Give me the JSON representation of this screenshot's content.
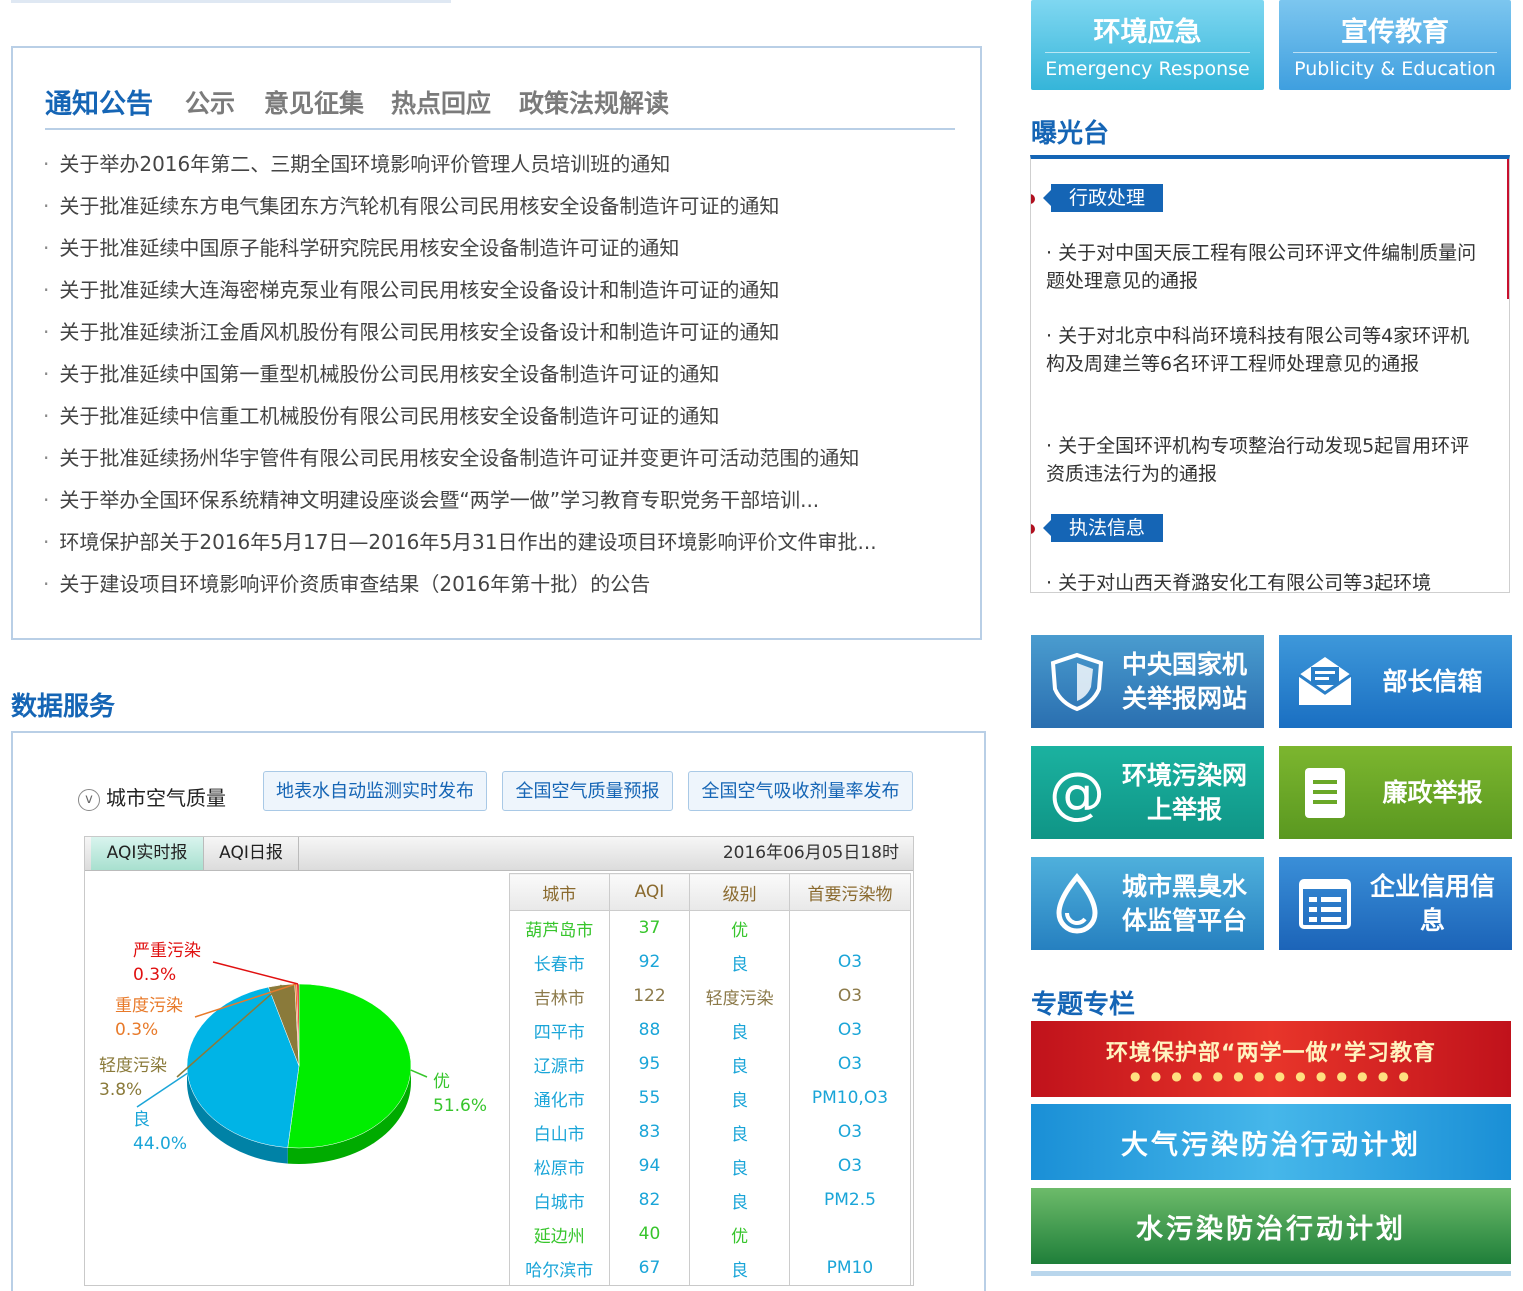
{
  "notice": {
    "tabs": [
      "通知公告",
      "公示",
      "意见征集",
      "热点回应",
      "政策法规解读"
    ],
    "items": [
      "关于举办2016年第二、三期全国环境影响评价管理人员培训班的通知",
      "关于批准延续东方电气集团东方汽轮机有限公司民用核安全设备制造许可证的通知",
      "关于批准延续中国原子能科学研究院民用核安全设备制造许可证的通知",
      "关于批准延续大连海密梯克泵业有限公司民用核安全设备设计和制造许可证的通知",
      "关于批准延续浙江金盾风机股份有限公司民用核安全设备设计和制造许可证的通知",
      "关于批准延续中国第一重型机械股份公司民用核安全设备制造许可证的通知",
      "关于批准延续中信重工机械股份有限公司民用核安全设备制造许可证的通知",
      "关于批准延续扬州华宇管件有限公司民用核安全设备制造许可证并变更许可活动范围的通知",
      "关于举办全国环保系统精神文明建设座谈会暨“两学一做”学习教育专职党务干部培训...",
      "环境保护部关于2016年5月17日—2016年5月31日作出的建设项目环境影响评价文件审批...",
      "关于建设项目环境影响评价资质审查结果（2016年第十批）的公告"
    ]
  },
  "data_service": {
    "title": "数据服务",
    "toggle_label": "城市空气质量",
    "toggle_icon": "v",
    "buttons": [
      "地表水自动监测实时发布",
      "全国空气质量预报",
      "全国空气吸收剂量率发布"
    ],
    "aqi_tabs": [
      "AQI实时报",
      "AQI日报"
    ],
    "date": "2016年06月05日18时",
    "table_headers": [
      "城市",
      "AQI",
      "级别",
      "首要污染物"
    ],
    "rows": [
      {
        "city": "葫芦岛市",
        "aqi": "37",
        "level": "优",
        "pollutant": "",
        "cls": "lv-you"
      },
      {
        "city": "长春市",
        "aqi": "92",
        "level": "良",
        "pollutant": "O3",
        "cls": "lv-liang"
      },
      {
        "city": "吉林市",
        "aqi": "122",
        "level": "轻度污染",
        "pollutant": "O3",
        "cls": "lv-qingdu"
      },
      {
        "city": "四平市",
        "aqi": "88",
        "level": "良",
        "pollutant": "O3",
        "cls": "lv-liang"
      },
      {
        "city": "辽源市",
        "aqi": "95",
        "level": "良",
        "pollutant": "O3",
        "cls": "lv-liang"
      },
      {
        "city": "通化市",
        "aqi": "55",
        "level": "良",
        "pollutant": "PM10,O3",
        "cls": "lv-liang"
      },
      {
        "city": "白山市",
        "aqi": "83",
        "level": "良",
        "pollutant": "O3",
        "cls": "lv-liang"
      },
      {
        "city": "松原市",
        "aqi": "94",
        "level": "良",
        "pollutant": "O3",
        "cls": "lv-liang"
      },
      {
        "city": "白城市",
        "aqi": "82",
        "level": "良",
        "pollutant": "PM2.5",
        "cls": "lv-liang"
      },
      {
        "city": "延边州",
        "aqi": "40",
        "level": "优",
        "pollutant": "",
        "cls": "lv-you"
      },
      {
        "city": "哈尔滨市",
        "aqi": "67",
        "level": "良",
        "pollutant": "PM10",
        "cls": "lv-liang"
      }
    ],
    "colors": {
      "you": "#00ee00",
      "liang": "#00b4e6",
      "qingdu": "#8a7a3a",
      "zhongdu": "#e87a2a",
      "yanzhong": "#e01010"
    }
  },
  "chart_data": {
    "type": "pie",
    "slices": [
      {
        "label": "优",
        "value": 51.6,
        "text": "51.6%",
        "color": "#00ee00"
      },
      {
        "label": "良",
        "value": 44.0,
        "text": "44.0%",
        "color": "#00b4e6"
      },
      {
        "label": "轻度污染",
        "value": 3.8,
        "text": "3.8%",
        "color": "#8a7a3a"
      },
      {
        "label": "重度污染",
        "value": 0.3,
        "text": "0.3%",
        "color": "#e87a2a"
      },
      {
        "label": "严重污染",
        "value": 0.3,
        "text": "0.3%",
        "color": "#e01010"
      }
    ]
  },
  "right": {
    "tile_emergency": {
      "cn": "环境应急",
      "en": "Emergency Response"
    },
    "tile_publicity": {
      "cn": "宣传教育",
      "en": "Publicity & Education"
    },
    "exposure_title": "曝光台",
    "exposure": {
      "cat1": "行政处理",
      "cat1_items": [
        "· 关于对中国天辰工程有限公司环评文件编制质量问题处理意见的通报",
        "· 关于对北京中科尚环境科技有限公司等4家环评机构及周建兰等6名环评工程师处理意见的通报",
        "· 关于全国环评机构专项整治行动发现5起冒用环评资质违法行为的通报"
      ],
      "cat2": "执法信息",
      "cat2_items": [
        "· 关于对山西天脊潞安化工有限公司等3起环境"
      ]
    },
    "tiles": {
      "jubao": "中央国家机关举报网站",
      "mailbox": "部长信箱",
      "pollution": "环境污染网上举报",
      "lianzheng": "廉政举报",
      "water": "城市黑臭水体监管平台",
      "credit": "企业信用信息"
    },
    "topic_title": "专题专栏",
    "banners": {
      "b1": "环境保护部“两学一做”学习教育",
      "b2": "大气污染防治行动计划",
      "b3": "水污染防治行动计划"
    }
  }
}
